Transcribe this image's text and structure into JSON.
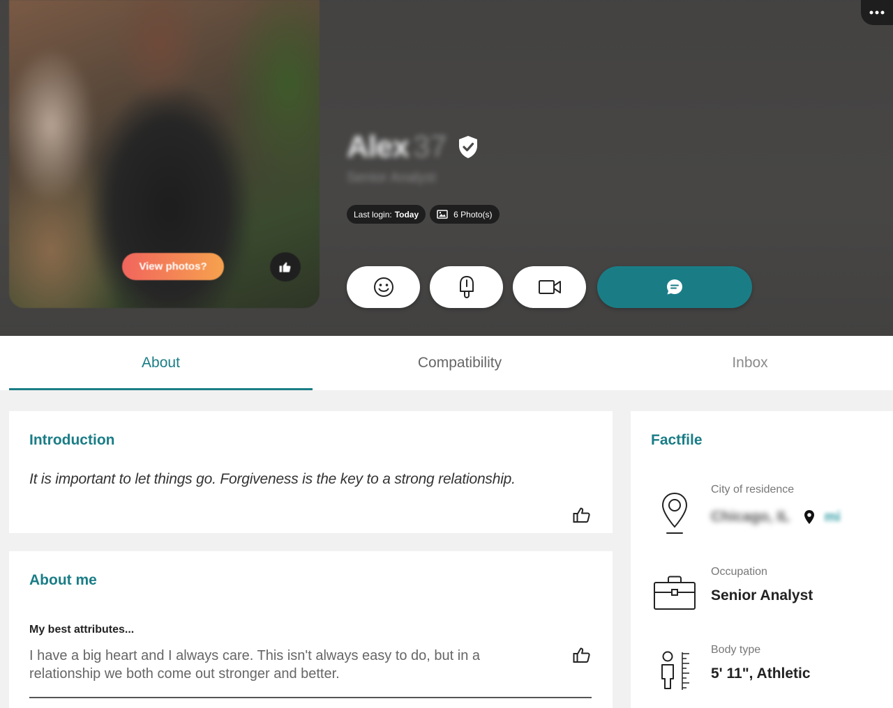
{
  "profile": {
    "name": "Alex",
    "age": "37",
    "job_title": "Senior Analyst",
    "last_login_label": "Last login:",
    "last_login_value": "Today",
    "photos_label": "6 Photo(s)",
    "view_photos_label": "View photos?"
  },
  "tabs": [
    {
      "label": "About",
      "active": true
    },
    {
      "label": "Compatibility",
      "active": false
    },
    {
      "label": "Inbox",
      "active": false
    }
  ],
  "introduction": {
    "title": "Introduction",
    "text": "It is important to let things go. Forgiveness is the key to a strong relationship."
  },
  "about_me": {
    "title": "About me",
    "attributes_title": "My best attributes...",
    "attributes_text": "I have a big heart and I always care. This isn't always easy to do, but in a relationship we both come out stronger and better."
  },
  "factfile": {
    "title": "Factfile",
    "city_label": "City of residence",
    "city_value": "Chicago, IL",
    "distance": "mi",
    "occupation_label": "Occupation",
    "occupation_value": "Senior Analyst",
    "body_label": "Body type",
    "body_value": "5' 11\", Athletic"
  },
  "colors": {
    "accent": "#1a7d86",
    "header_bg": "#4b4a49",
    "view_photos_gradient": [
      "#f2655d",
      "#f6a24e"
    ]
  },
  "icons": [
    "verified-shield-icon",
    "image-icon",
    "smile-icon",
    "ice-lolly-icon",
    "video-camera-icon",
    "chat-icon",
    "more-icon",
    "thumbs-up-icon",
    "map-pin-icon",
    "briefcase-icon",
    "height-icon"
  ]
}
